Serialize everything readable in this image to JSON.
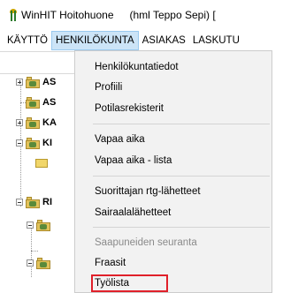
{
  "window": {
    "app_icon": "flower-plant-icon",
    "title": "WinHIT Hoitohuone",
    "user_info": "(hml Teppo Sepi) ["
  },
  "menubar": {
    "items": [
      {
        "label": "KÄYTTÖ"
      },
      {
        "label": "HENKILÖKUNTA",
        "open": true
      },
      {
        "label": "ASIAKAS"
      },
      {
        "label": "LASKUTU"
      }
    ]
  },
  "dropdown": {
    "items": [
      {
        "label": "Henkilökuntatiedot",
        "enabled": true
      },
      {
        "label": "Profiili",
        "enabled": true
      },
      {
        "label": "Potilasrekisterit",
        "enabled": true
      },
      {
        "label": "Vapaa aika",
        "enabled": true
      },
      {
        "label": "Vapaa aika - lista",
        "enabled": true
      },
      {
        "label": "Suorittajan rtg-lähetteet",
        "enabled": true
      },
      {
        "label": "Sairaalalähetteet",
        "enabled": true
      },
      {
        "label": "Saapuneiden seuranta",
        "enabled": false
      },
      {
        "label": "Fraasit",
        "enabled": true
      },
      {
        "label": "Työlista",
        "enabled": true,
        "highlighted": true
      }
    ],
    "highlight_color": "#e0202a"
  },
  "tree": {
    "nodes": [
      {
        "label": "AS",
        "icon": "folder-icon",
        "expander": "plus"
      },
      {
        "label": "AS",
        "icon": "folder-icon",
        "expander": "none"
      },
      {
        "label": "KA",
        "icon": "folder-icon",
        "expander": "plus"
      },
      {
        "label": "KI",
        "icon": "folder-icon",
        "expander": "minus"
      },
      {
        "label": "RI",
        "icon": "folder-icon",
        "expander": "minus"
      }
    ]
  },
  "colors": {
    "menu_open_bg": "#cce4f7",
    "dropdown_bg": "#f2f2f2",
    "disabled_text": "#8a8a8a"
  }
}
